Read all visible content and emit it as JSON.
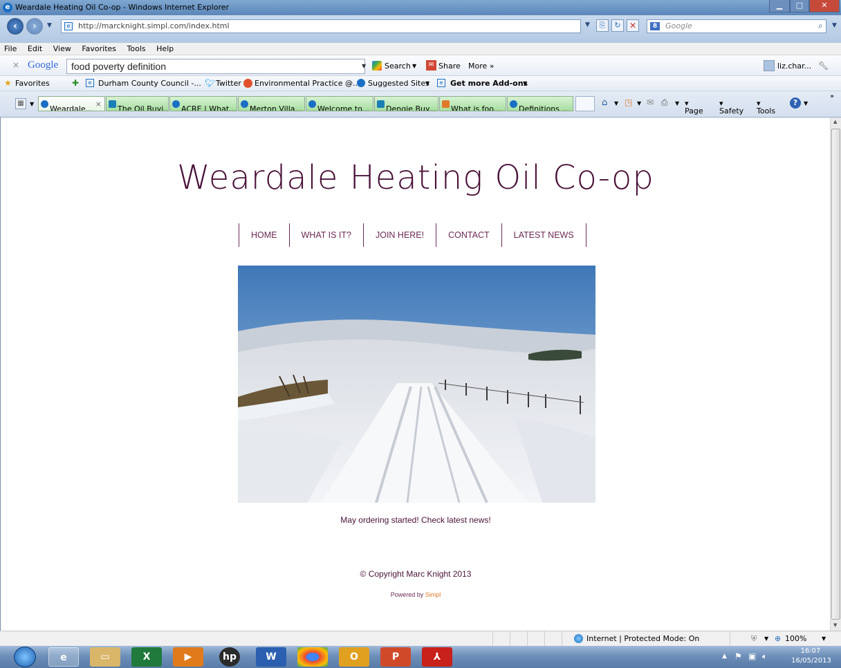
{
  "window": {
    "title": "Weardale Heating Oil Co-op - Windows Internet Explorer"
  },
  "address": {
    "url": "http://marcknight.simpl.com/index.html",
    "search_placeholder": "Google"
  },
  "menu": [
    "File",
    "Edit",
    "View",
    "Favorites",
    "Tools",
    "Help"
  ],
  "google_toolbar": {
    "logo": "Google",
    "query": "food poverty definition",
    "search_label": "Search",
    "share_label": "Share",
    "more_label": "More »",
    "user": "liz.char..."
  },
  "favorites_bar": {
    "favorites_label": "Favorites",
    "items": [
      "Durham County Council -...",
      "Twitter",
      "Environmental Practice @...",
      "Suggested Sites",
      "Get more Add-ons"
    ]
  },
  "tabs": [
    "Weardale...",
    "The Oil Buyi...",
    "ACRE | What...",
    "Merton Villa...",
    "Welcome to...",
    "Dengie Buy...",
    "What is foo...",
    "Definitions ..."
  ],
  "command_bar": {
    "page": "Page",
    "safety": "Safety",
    "tools": "Tools"
  },
  "site": {
    "title": "Weardale Heating Oil Co-op",
    "nav": [
      "HOME",
      "WHAT IS IT?",
      "JOIN HERE!",
      "CONTACT",
      "LATEST NEWS"
    ],
    "tagline": "May ordering started! Check latest news!",
    "copyright": "© Copyright Marc Knight 2013",
    "powered_by": "Powered by",
    "powered_link": "Simpl"
  },
  "status": {
    "zone": "Internet | Protected Mode: On",
    "zoom": "100%"
  },
  "taskbar": {
    "time": "16:07",
    "date": "16/05/2013"
  },
  "colors": {
    "site_text": "#4a1238",
    "nav_text": "#6b2a55",
    "powered_link": "#e07a2a",
    "tab_green": "#a7dfa0"
  }
}
